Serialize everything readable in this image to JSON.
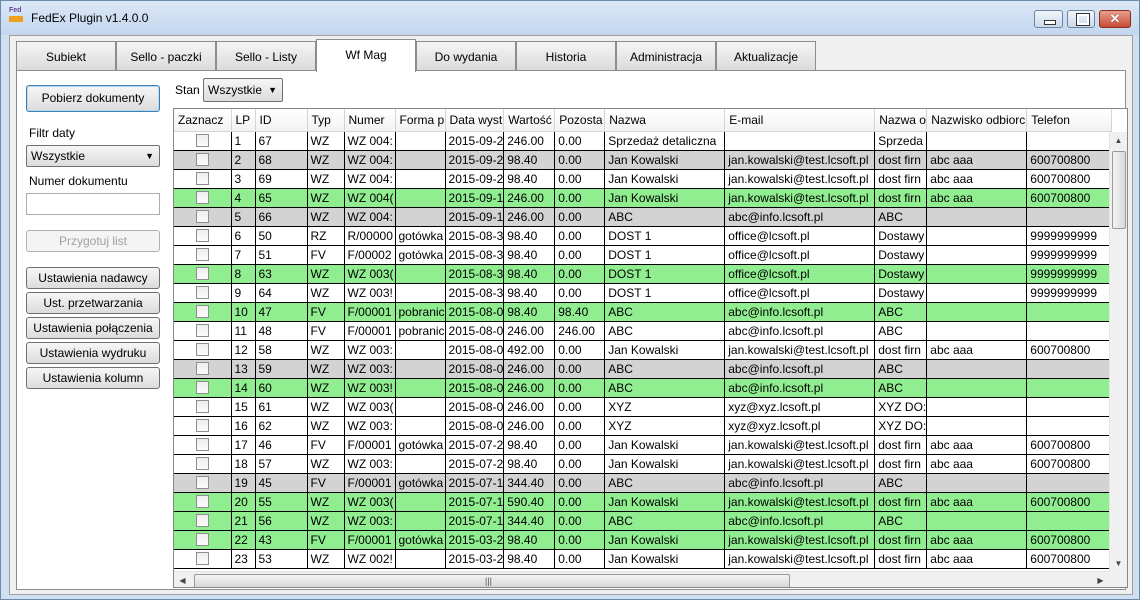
{
  "window": {
    "title": "FedEx Plugin v1.4.0.0",
    "icon_text": "Fed"
  },
  "tabs": [
    {
      "label": "Subiekt"
    },
    {
      "label": "Sello - paczki"
    },
    {
      "label": "Sello - Listy"
    },
    {
      "label": "Wf Mag",
      "active": true
    },
    {
      "label": "Do wydania"
    },
    {
      "label": "Historia"
    },
    {
      "label": "Administracja"
    },
    {
      "label": "Aktualizacje"
    }
  ],
  "sidebar": {
    "fetch_button": "Pobierz dokumenty",
    "date_filter_label": "Filtr daty",
    "date_filter_value": "Wszystkie",
    "doc_number_label": "Numer dokumentu",
    "doc_number_value": "",
    "prepare_button": "Przygotuj list",
    "settings_buttons": [
      "Ustawienia nadawcy",
      "Ust. przetwarzania",
      "Ustawienia połączenia",
      "Ustawienia wydruku",
      "Ustawienia kolumn"
    ]
  },
  "status_filter": {
    "label": "Stan",
    "value": "Wszystkie"
  },
  "grid": {
    "columns": [
      "Zaznacz",
      "LP",
      "ID",
      "Typ",
      "Numer",
      "Forma p",
      "Data wyst",
      "Wartość",
      "Pozosta",
      "Nazwa",
      "E-mail",
      "Nazwa o",
      "Nazwisko odbiorc",
      "Telefon"
    ],
    "rows": [
      {
        "style": "white",
        "cells": [
          "",
          "1",
          "67",
          "WZ",
          "WZ 004:",
          "",
          "2015-09-2",
          "246.00",
          "0.00",
          "Sprzedaż detaliczna",
          "",
          "Sprzeda",
          "",
          ""
        ]
      },
      {
        "style": "gray",
        "cells": [
          "",
          "2",
          "68",
          "WZ",
          "WZ 004:",
          "",
          "2015-09-2",
          "98.40",
          "0.00",
          "Jan Kowalski",
          "jan.kowalski@test.lcsoft.pl",
          "dost firn",
          "abc  aaa",
          "600700800"
        ]
      },
      {
        "style": "white",
        "cells": [
          "",
          "3",
          "69",
          "WZ",
          "WZ 004:",
          "",
          "2015-09-2",
          "98.40",
          "0.00",
          "Jan Kowalski",
          "jan.kowalski@test.lcsoft.pl",
          "dost firn",
          "abc  aaa",
          "600700800"
        ]
      },
      {
        "style": "green",
        "cells": [
          "",
          "4",
          "65",
          "WZ",
          "WZ 004(",
          "",
          "2015-09-1",
          "246.00",
          "0.00",
          "Jan Kowalski",
          "jan.kowalski@test.lcsoft.pl",
          "dost firn",
          "abc  aaa",
          "600700800"
        ]
      },
      {
        "style": "gray",
        "cells": [
          "",
          "5",
          "66",
          "WZ",
          "WZ 004:",
          "",
          "2015-09-1",
          "246.00",
          "0.00",
          "ABC",
          "abc@info.lcsoft.pl",
          "ABC",
          "",
          ""
        ]
      },
      {
        "style": "white",
        "cells": [
          "",
          "6",
          "50",
          "RZ",
          "R/00000",
          "gotówka",
          "2015-08-3",
          "98.40",
          "0.00",
          "DOST 1",
          "office@lcsoft.pl",
          "Dostawy",
          "",
          "9999999999"
        ]
      },
      {
        "style": "white",
        "cells": [
          "",
          "7",
          "51",
          "FV",
          "F/00002",
          "gotówka",
          "2015-08-3",
          "98.40",
          "0.00",
          "DOST 1",
          "office@lcsoft.pl",
          "Dostawy",
          "",
          "9999999999"
        ]
      },
      {
        "style": "green",
        "cells": [
          "",
          "8",
          "63",
          "WZ",
          "WZ 003(",
          "",
          "2015-08-3",
          "98.40",
          "0.00",
          "DOST 1",
          "office@lcsoft.pl",
          "Dostawy",
          "",
          "9999999999"
        ]
      },
      {
        "style": "white",
        "cells": [
          "",
          "9",
          "64",
          "WZ",
          "WZ 003!",
          "",
          "2015-08-3",
          "98.40",
          "0.00",
          "DOST 1",
          "office@lcsoft.pl",
          "Dostawy",
          "",
          "9999999999"
        ]
      },
      {
        "style": "green",
        "cells": [
          "",
          "10",
          "47",
          "FV",
          "F/00001",
          "pobranic",
          "2015-08-0",
          "98.40",
          "98.40",
          "ABC",
          "abc@info.lcsoft.pl",
          "ABC",
          "",
          ""
        ]
      },
      {
        "style": "white",
        "cells": [
          "",
          "11",
          "48",
          "FV",
          "F/00001",
          "pobranic",
          "2015-08-0",
          "246.00",
          "246.00",
          "ABC",
          "abc@info.lcsoft.pl",
          "ABC",
          "",
          ""
        ]
      },
      {
        "style": "white",
        "cells": [
          "",
          "12",
          "58",
          "WZ",
          "WZ 003:",
          "",
          "2015-08-0",
          "492.00",
          "0.00",
          "Jan Kowalski",
          "jan.kowalski@test.lcsoft.pl",
          "dost firn",
          "abc  aaa",
          "600700800"
        ]
      },
      {
        "style": "gray",
        "cells": [
          "",
          "13",
          "59",
          "WZ",
          "WZ 003:",
          "",
          "2015-08-0",
          "246.00",
          "0.00",
          "ABC",
          "abc@info.lcsoft.pl",
          "ABC",
          "",
          ""
        ]
      },
      {
        "style": "green",
        "cells": [
          "",
          "14",
          "60",
          "WZ",
          "WZ 003!",
          "",
          "2015-08-0",
          "246.00",
          "0.00",
          "ABC",
          "abc@info.lcsoft.pl",
          "ABC",
          "",
          ""
        ]
      },
      {
        "style": "white",
        "cells": [
          "",
          "15",
          "61",
          "WZ",
          "WZ 003(",
          "",
          "2015-08-0",
          "246.00",
          "0.00",
          "XYZ",
          "xyz@xyz.lcsoft.pl",
          "XYZ DO:",
          "",
          ""
        ]
      },
      {
        "style": "white",
        "cells": [
          "",
          "16",
          "62",
          "WZ",
          "WZ 003:",
          "",
          "2015-08-0",
          "246.00",
          "0.00",
          "XYZ",
          "xyz@xyz.lcsoft.pl",
          "XYZ DO:",
          "",
          ""
        ]
      },
      {
        "style": "white",
        "cells": [
          "",
          "17",
          "46",
          "FV",
          "F/00001",
          "gotówka",
          "2015-07-2",
          "98.40",
          "0.00",
          "Jan Kowalski",
          "jan.kowalski@test.lcsoft.pl",
          "dost firn",
          "abc  aaa",
          "600700800"
        ]
      },
      {
        "style": "white",
        "cells": [
          "",
          "18",
          "57",
          "WZ",
          "WZ 003:",
          "",
          "2015-07-2",
          "98.40",
          "0.00",
          "Jan Kowalski",
          "jan.kowalski@test.lcsoft.pl",
          "dost firn",
          "abc  aaa",
          "600700800"
        ]
      },
      {
        "style": "gray",
        "cells": [
          "",
          "19",
          "45",
          "FV",
          "F/00001",
          "gotówka",
          "2015-07-1",
          "344.40",
          "0.00",
          "ABC",
          "abc@info.lcsoft.pl",
          "ABC",
          "",
          ""
        ]
      },
      {
        "style": "green",
        "cells": [
          "",
          "20",
          "55",
          "WZ",
          "WZ 003(",
          "",
          "2015-07-1",
          "590.40",
          "0.00",
          "Jan Kowalski",
          "jan.kowalski@test.lcsoft.pl",
          "dost firn",
          "abc  aaa",
          "600700800"
        ]
      },
      {
        "style": "green",
        "cells": [
          "",
          "21",
          "56",
          "WZ",
          "WZ 003:",
          "",
          "2015-07-1",
          "344.40",
          "0.00",
          "ABC",
          "abc@info.lcsoft.pl",
          "ABC",
          "",
          ""
        ]
      },
      {
        "style": "green",
        "cells": [
          "",
          "22",
          "43",
          "FV",
          "F/00001",
          "gotówka",
          "2015-03-2",
          "98.40",
          "0.00",
          "Jan Kowalski",
          "jan.kowalski@test.lcsoft.pl",
          "dost firn",
          "abc  aaa",
          "600700800"
        ]
      },
      {
        "style": "white",
        "cells": [
          "",
          "23",
          "53",
          "WZ",
          "WZ 002!",
          "",
          "2015-03-2",
          "98.40",
          "0.00",
          "Jan Kowalski",
          "jan.kowalski@test.lcsoft.pl",
          "dost firn",
          "abc  aaa",
          "600700800"
        ]
      }
    ]
  }
}
